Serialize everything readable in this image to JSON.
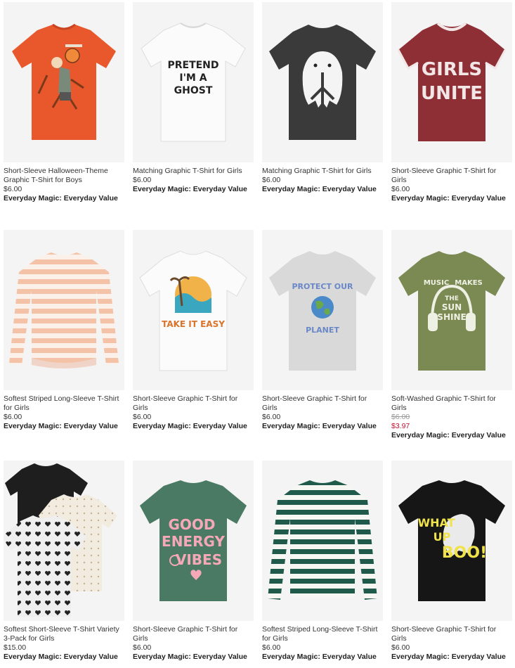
{
  "products": [
    {
      "title": "Short-Sleeve Halloween-Theme Graphic T-Shirt for Boys",
      "price": "$6.00",
      "promo": "Everyday Magic: Everyday Value",
      "icon": "tshirt-orange-basketball"
    },
    {
      "title": "Matching Graphic T-Shirt for Girls",
      "price": "$6.00",
      "promo": "Everyday Magic: Everyday Value",
      "icon": "tshirt-white-pretend-ghost",
      "graphic": [
        "PRETEND",
        "I'M A",
        "GHOST"
      ]
    },
    {
      "title": "Matching Graphic T-Shirt for Girls",
      "price": "$6.00",
      "promo": "Everyday Magic: Everyday Value",
      "icon": "tshirt-black-peace-ghost"
    },
    {
      "title": "Short-Sleeve Graphic T-Shirt for Girls",
      "price": "$6.00",
      "promo": "Everyday Magic: Everyday Value",
      "icon": "tshirt-maroon-girls-unite",
      "graphic": [
        "GIRLS",
        "UNITE"
      ]
    },
    {
      "title": "Softest Striped Long-Sleeve T-Shirt for Girls",
      "price": "$6.00",
      "promo": "Everyday Magic: Everyday Value",
      "icon": "longsleeve-peach-striped"
    },
    {
      "title": "Short-Sleeve Graphic T-Shirt for Girls",
      "price": "$6.00",
      "promo": "Everyday Magic: Everyday Value",
      "icon": "tshirt-white-take-it-easy",
      "graphic": [
        "TAKE IT EASY"
      ]
    },
    {
      "title": "Short-Sleeve Graphic T-Shirt for Girls",
      "price": "$6.00",
      "promo": "Everyday Magic: Everyday Value",
      "icon": "tshirt-gray-protect-planet",
      "graphic": [
        "PROTECT OUR",
        "PLANET"
      ]
    },
    {
      "title": "Soft-Washed Graphic T-Shirt for Girls",
      "price_original": "$6.00",
      "price_sale": "$3.97",
      "promo": "Everyday Magic: Everyday Value",
      "icon": "tshirt-olive-music-sunshine",
      "graphic": [
        "MUSIC",
        "MAKES",
        "THE",
        "SUN",
        "SHINE"
      ]
    },
    {
      "title": "Softest Short-Sleeve T-Shirt Variety 3-Pack for Girls",
      "price": "$15.00",
      "promo": "Everyday Magic: Everyday Value",
      "icon": "tshirt-3pack-hearts"
    },
    {
      "title": "Short-Sleeve Graphic T-Shirt for Girls",
      "price": "$6.00",
      "promo": "Everyday Magic: Everyday Value",
      "icon": "tshirt-green-good-energy",
      "graphic": [
        "GOOD",
        "ENERGY",
        "VIBES"
      ]
    },
    {
      "title": "Softest Striped Long-Sleeve T-Shirt for Girls",
      "price": "$6.00",
      "promo": "Everyday Magic: Everyday Value",
      "icon": "longsleeve-green-striped"
    },
    {
      "title": "Short-Sleeve Graphic T-Shirt for Girls",
      "price": "$6.00",
      "promo": "Everyday Magic: Everyday Value",
      "icon": "tshirt-black-what-up-boo",
      "graphic": [
        "WHAT",
        "UP",
        "BOO!"
      ]
    }
  ],
  "colors": {
    "sale": "#c41230",
    "tile_bg": "#f4f4f4"
  }
}
